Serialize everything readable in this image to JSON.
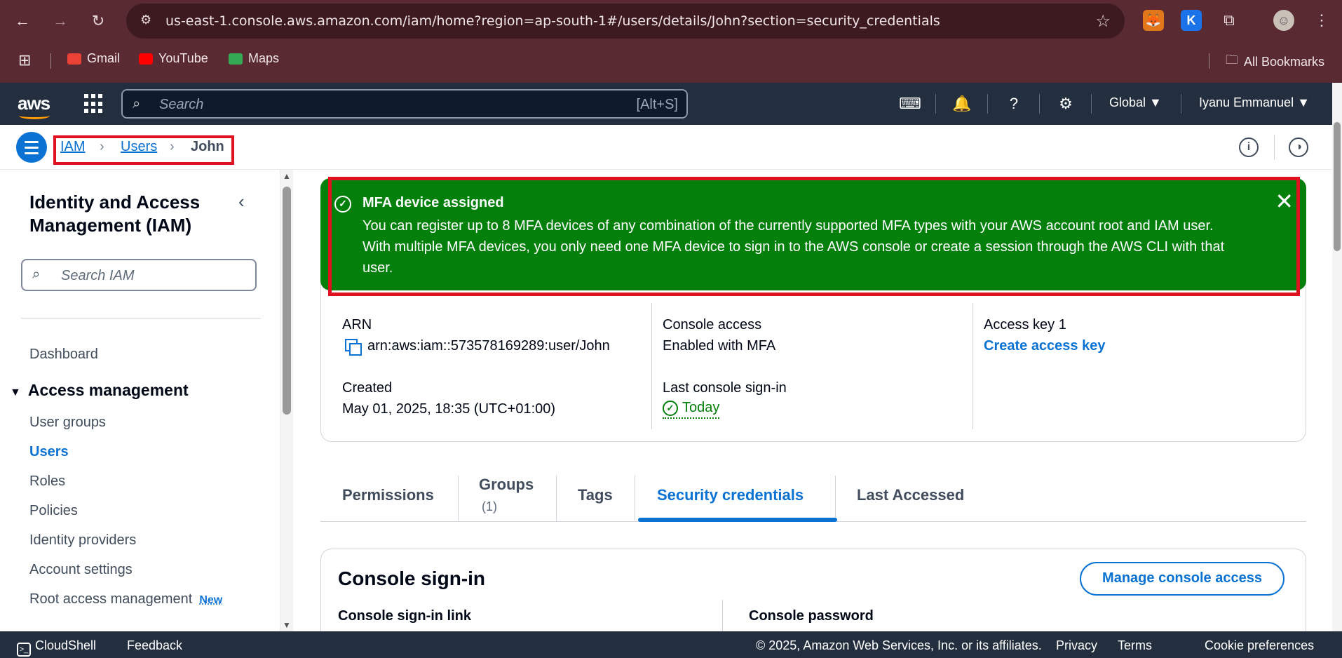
{
  "browser": {
    "url": "us-east-1.console.aws.amazon.com/iam/home?region=ap-south-1#/users/details/John?section=security_credentials",
    "bookmarks": [
      {
        "label": "Gmail",
        "color": "#ea4335"
      },
      {
        "label": "YouTube",
        "color": "#ff0000"
      },
      {
        "label": "Maps",
        "color": "#34a853"
      }
    ],
    "all_bookmarks": "All Bookmarks"
  },
  "aws_header": {
    "logo": "aws",
    "search_placeholder": "Search",
    "search_shortcut": "[Alt+S]",
    "region": "Global ▼",
    "user": "Iyanu Emmanuel ▼"
  },
  "breadcrumb": {
    "items": [
      "IAM",
      "Users",
      "John"
    ],
    "separator": "›"
  },
  "sidebar": {
    "title": "Identity and Access Management (IAM)",
    "search_placeholder": "Search IAM",
    "dashboard": "Dashboard",
    "section": "Access management",
    "items": [
      {
        "label": "User groups",
        "active": false
      },
      {
        "label": "Users",
        "active": true
      },
      {
        "label": "Roles",
        "active": false
      },
      {
        "label": "Policies",
        "active": false
      },
      {
        "label": "Identity providers",
        "active": false
      },
      {
        "label": "Account settings",
        "active": false
      },
      {
        "label": "Root access management",
        "active": false
      }
    ],
    "new_badge": "New"
  },
  "flash": {
    "title": "MFA device assigned",
    "message": "You can register up to 8 MFA devices of any combination of the currently supported MFA types with your AWS account root and IAM user. With multiple MFA devices, you only need one MFA device to sign in to the AWS console or create a session through the AWS CLI with that user.",
    "color": "#037f0c"
  },
  "summary": {
    "arn_label": "ARN",
    "arn_value": "arn:aws:iam::573578169289:user/John",
    "created_label": "Created",
    "created_value": "May 01, 2025, 18:35 (UTC+01:00)",
    "console_access_label": "Console access",
    "console_access_value": "Enabled with MFA",
    "last_signin_label": "Last console sign-in",
    "last_signin_value": "Today",
    "access_key_label": "Access key 1",
    "access_key_link": "Create access key"
  },
  "tabs": [
    {
      "label": "Permissions",
      "count": ""
    },
    {
      "label": "Groups",
      "count": "(1)"
    },
    {
      "label": "Tags",
      "count": ""
    },
    {
      "label": "Security credentials",
      "count": "",
      "active": true
    },
    {
      "label": "Last Accessed",
      "count": ""
    }
  ],
  "console_signin": {
    "title": "Console sign-in",
    "manage_button": "Manage console access",
    "link_label": "Console sign-in link",
    "password_label": "Console password"
  },
  "footer": {
    "cloudshell": "CloudShell",
    "feedback": "Feedback",
    "copyright": "© 2025, Amazon Web Services, Inc. or its affiliates.",
    "privacy": "Privacy",
    "terms": "Terms",
    "cookies": "Cookie preferences"
  },
  "colors": {
    "accent": "#0972d3",
    "aws_header": "#232f3e",
    "browser_frame": "#5a2a33",
    "highlight_box": "#e0121f"
  }
}
